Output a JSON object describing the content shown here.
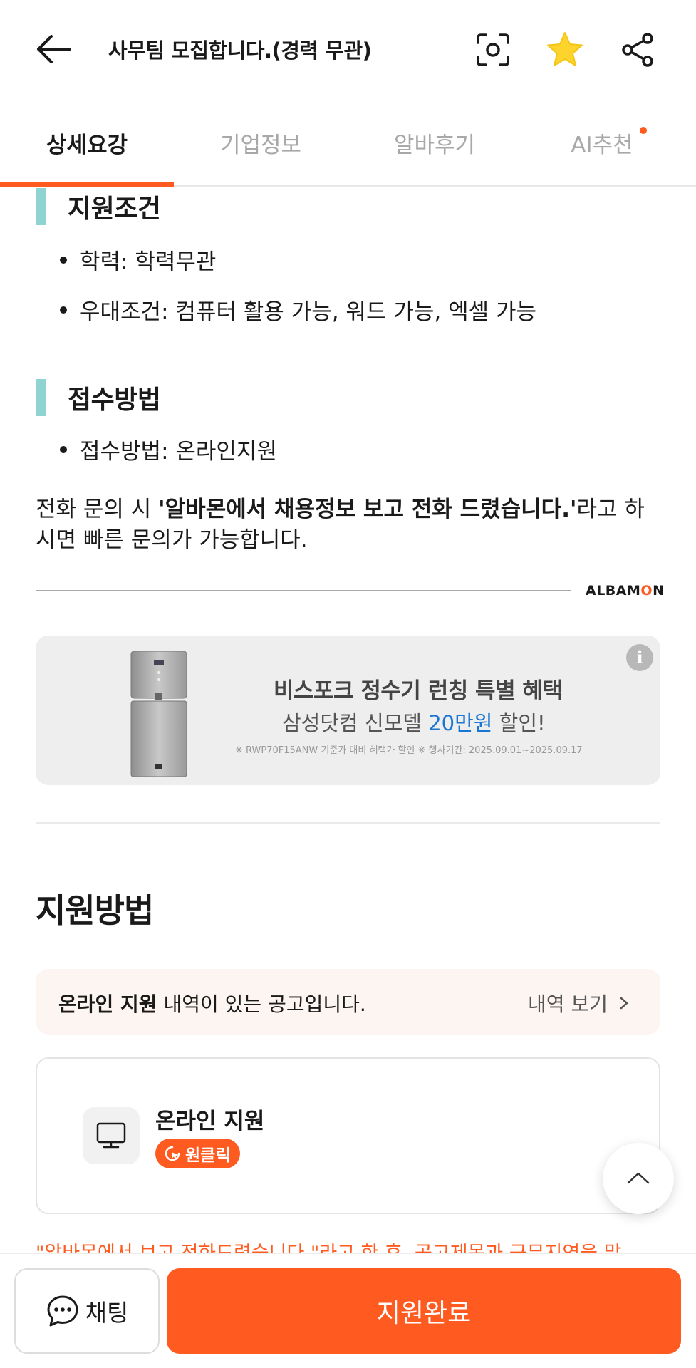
{
  "header": {
    "title": "사무팀 모집합니다.(경력 무관)",
    "icons": [
      "back-arrow-icon",
      "scan-icon",
      "star-icon",
      "share-icon"
    ],
    "star_color": "#fcd42c"
  },
  "tabs": [
    {
      "label": "상세요강",
      "active": true
    },
    {
      "label": "기업정보",
      "active": false
    },
    {
      "label": "알바후기",
      "active": false
    },
    {
      "label": "AI추천",
      "active": false,
      "has_dot": true
    }
  ],
  "requirements": {
    "heading": "지원조건",
    "items": [
      "학력: 학력무관",
      "우대조건: 컴퓨터 활용 가능, 워드 가능, 엑셀 가능"
    ]
  },
  "application_method": {
    "heading": "접수방법",
    "items": [
      "접수방법: 온라인지원"
    ]
  },
  "phone_note": {
    "prefix": "전화 문의 시 ",
    "bold": "'알바몬에서 채용정보 보고 전화 드렸습니다.'",
    "suffix": "라고 하시면 빠른 문의가 가능합니다."
  },
  "brand": {
    "name_part1": "ALBAM",
    "name_o": "O",
    "name_part2": "N",
    "accent": "#ff5a1f"
  },
  "ad": {
    "line1": "비스포크 정수기 런칭 특별 혜택",
    "line2_prefix": "삼성닷컴 신모델 ",
    "line2_highlight": "20만원",
    "line2_suffix": " 할인!",
    "line3": "※ RWP70F15ANW 기준가 대비 혜택가 할인 ※ 행사기간: 2025.09.01~2025.09.17",
    "info_symbol": "i"
  },
  "apply_section": {
    "heading": "지원방법",
    "notice_bold": "온라인 지원",
    "notice_text": " 내역이 있는 공고입니다.",
    "notice_link": "내역 보기",
    "option_title": "온라인 지원",
    "badge": "원클릭",
    "orange_note": "\"알바몬에서 보고 전화드렸습니다.\"라고 한 후, 공고제목과 근무지역을 말"
  },
  "bottom": {
    "chat_label": "채팅",
    "apply_label": "지원완료"
  }
}
